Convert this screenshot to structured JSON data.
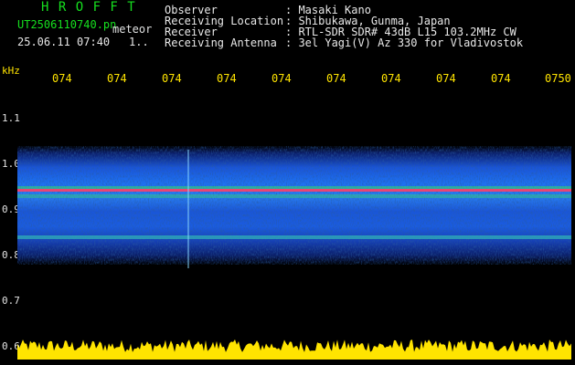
{
  "header": {
    "brand": "H R O F F T",
    "filename": "UT2506110740.pn",
    "tag": "meteor",
    "datetime": "25.06.11 07:40",
    "ellipsis": "1..",
    "rows": [
      {
        "label": "Observer",
        "value": ": Masaki Kano"
      },
      {
        "label": "Receiving Location",
        "value": ": Shibukawa, Gunma, Japan"
      },
      {
        "label": "Receiver",
        "value": ": RTL-SDR SDR# 43dB L15 103.2MHz CW"
      },
      {
        "label": "Receiving Antenna",
        "value": ": 3el Yagi(V) Az 330 for Vladivostok"
      }
    ]
  },
  "spectrogram": {
    "y_unit": "kHz",
    "x_ticks": [
      "074",
      "074",
      "074",
      "074",
      "074",
      "074",
      "074",
      "074",
      "074",
      "0750"
    ],
    "y_ticks": [
      "1.1",
      "1.0",
      "0.9",
      "0.8",
      "0.7",
      "0.6"
    ],
    "colors": {
      "background": "#000000",
      "axis_text": "#ffe400",
      "header_green": "#16e01f",
      "trace": "#ffe400",
      "carrier": "#ff3a6e"
    }
  }
}
